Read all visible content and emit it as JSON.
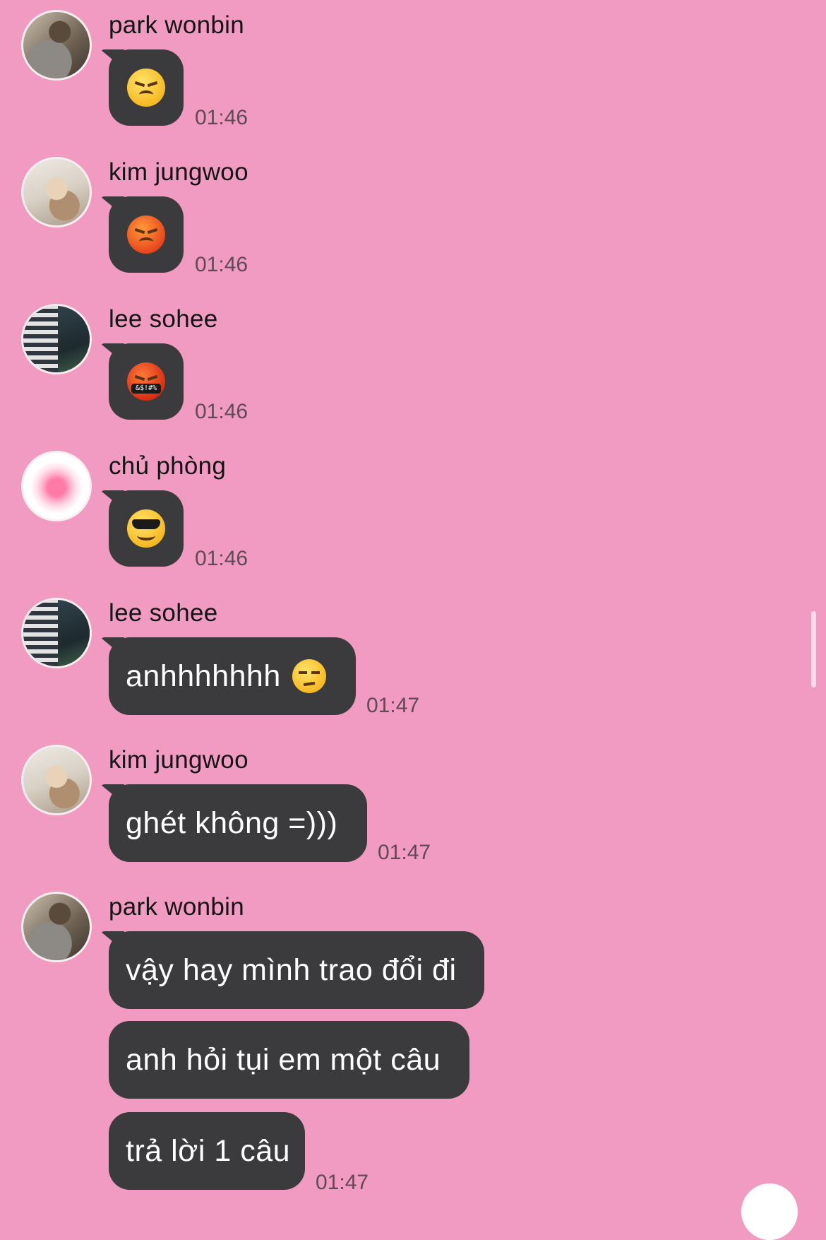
{
  "chat": {
    "messages": [
      {
        "sender": "park wonbin",
        "avatar": "park-wonbin-avatar",
        "content_type": "emoji",
        "emoji": "😠",
        "time": "01:46"
      },
      {
        "sender": "kim jungwoo",
        "avatar": "kim-jungwoo-avatar",
        "content_type": "emoji",
        "emoji": "😡",
        "time": "01:46"
      },
      {
        "sender": "lee sohee",
        "avatar": "lee-sohee-avatar",
        "content_type": "emoji",
        "emoji": "🤬",
        "time": "01:46"
      },
      {
        "sender": "chủ phòng",
        "avatar": "heart-avatar",
        "content_type": "emoji",
        "emoji": "😎",
        "time": "01:46"
      },
      {
        "sender": "lee sohee",
        "avatar": "lee-sohee-avatar",
        "content_type": "text",
        "text": "anhhhhhhh",
        "emoji": "😒",
        "time": "01:47"
      },
      {
        "sender": "kim jungwoo",
        "avatar": "kim-jungwoo-avatar",
        "content_type": "text",
        "text": "ghét không =)))",
        "time": "01:47"
      },
      {
        "sender": "park wonbin",
        "avatar": "park-wonbin-avatar",
        "content_type": "text-multi",
        "lines": [
          "vậy hay mình trao đổi đi",
          "anh hỏi tụi em một câu",
          "trả lời 1 câu"
        ],
        "time": "01:47"
      }
    ],
    "colors": {
      "background": "#f29bc2",
      "bubble": "#3b3b3d",
      "bubble_text": "#ffffff",
      "name_text": "#141414",
      "time_text": "#5f4a55"
    }
  }
}
